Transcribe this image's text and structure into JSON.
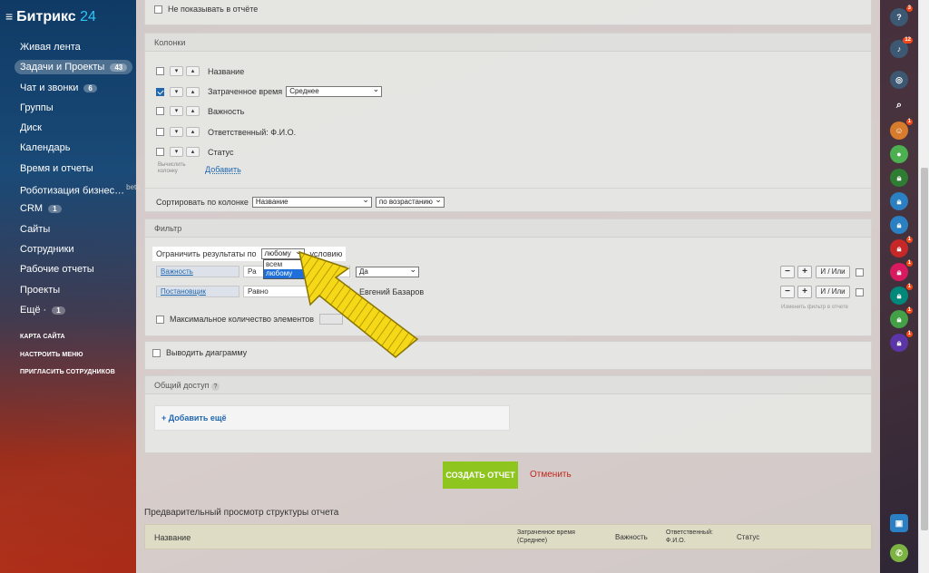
{
  "brand": {
    "name": "Битрикс",
    "num": "24"
  },
  "nav": [
    {
      "label": "Живая лента"
    },
    {
      "label": "Задачи и Проекты",
      "badge": "43"
    },
    {
      "label": "Чат и звонки",
      "badge": "6"
    },
    {
      "label": "Группы"
    },
    {
      "label": "Диск"
    },
    {
      "label": "Календарь"
    },
    {
      "label": "Время и отчеты"
    },
    {
      "label": "Роботизация бизнес…",
      "beta": "beta"
    },
    {
      "label": "CRM",
      "badge": "1"
    },
    {
      "label": "Сайты"
    },
    {
      "label": "Сотрудники"
    },
    {
      "label": "Рабочие отчеты"
    },
    {
      "label": "Проекты"
    },
    {
      "label": "Ещё ·",
      "badge": "1"
    }
  ],
  "nav_links": [
    "КАРТА САЙТА",
    "НАСТРОИТЬ МЕНЮ",
    "ПРИГЛАСИТЬ СОТРУДНИКОВ"
  ],
  "top": {
    "hide_label": "Не показывать в отчёте"
  },
  "columns": {
    "title": "Колонки",
    "items": [
      {
        "name": "Название",
        "checked": false
      },
      {
        "name": "Затраченное время",
        "checked": true,
        "agg": "Среднее"
      },
      {
        "name": "Важность",
        "checked": false
      },
      {
        "name": "Ответственный: Ф.И.О.",
        "checked": false
      },
      {
        "name": "Статус",
        "checked": false
      }
    ],
    "calc_hint": "Вычислить колонку",
    "add_link": "Добавить",
    "sort_label": "Сортировать по колонке",
    "sort_column": "Название",
    "sort_order": "по возрастанию"
  },
  "filter": {
    "title": "Фильтр",
    "limit_label": "Ограничить результаты по",
    "limit_value": "любому",
    "limit_suffix": "условию",
    "dropdown_options": [
      "всем",
      "любому"
    ],
    "rows": [
      {
        "field": "Важность",
        "op": "Ра",
        "value": "Да"
      },
      {
        "field": "Постановщик",
        "op": "Равно",
        "value": "Евгений Базаров"
      }
    ],
    "and_or": "И / Или",
    "change_hint": "Изменить фильтр в отчете",
    "max_label": "Максимальное количество элементов"
  },
  "diagram": {
    "label": "Выводить диаграмму"
  },
  "access": {
    "title": "Общий доступ",
    "help": "?",
    "add_more": "+ Добавить ещё"
  },
  "actions": {
    "create": "СОЗДАТЬ ОТЧЕТ",
    "cancel": "Отменить"
  },
  "preview": {
    "title": "Предварительный просмотр структуры отчета",
    "headers": [
      "Название",
      "Затраченное время (Среднее)",
      "Важность",
      "Ответственный: Ф.И.О.",
      "Статус"
    ]
  },
  "rightbar": {
    "icons": [
      {
        "name": "help-icon",
        "badge": "3"
      },
      {
        "name": "bell-icon",
        "badge": "12"
      },
      {
        "name": "chat-icon"
      },
      {
        "name": "search-icon"
      },
      {
        "name": "avatar-icon",
        "badge": "1"
      },
      {
        "name": "user-icon"
      },
      {
        "name": "lock-icon"
      },
      {
        "name": "lock-icon"
      },
      {
        "name": "lock-icon"
      },
      {
        "name": "lock-icon",
        "badge": "1"
      },
      {
        "name": "lock-icon",
        "badge": "1"
      },
      {
        "name": "lock-icon",
        "badge": "1"
      },
      {
        "name": "lock-icon",
        "badge": "1"
      },
      {
        "name": "lock-icon",
        "badge": "1"
      },
      {
        "name": "phone-icon"
      }
    ]
  },
  "colors": {
    "accent": "#8ec51f",
    "link": "#2067b0",
    "cancel": "#c0271c"
  }
}
